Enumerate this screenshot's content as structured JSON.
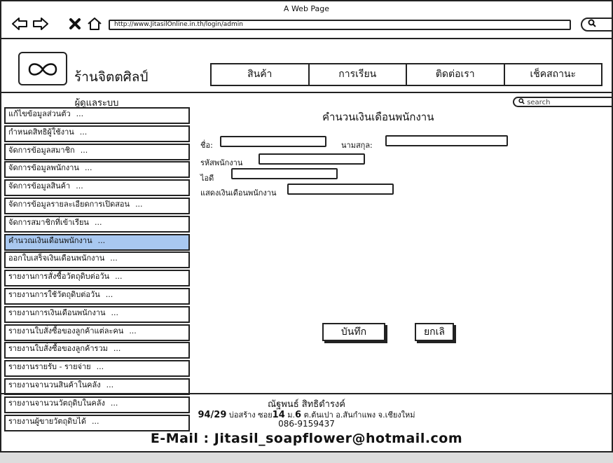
{
  "window": {
    "title": "A Web Page"
  },
  "browser": {
    "url": "http://www.JitasilOnline.in.th/login/admin",
    "back_icon": "back-arrow-icon",
    "forward_icon": "forward-arrow-icon",
    "close_icon": "close-icon",
    "home_icon": "home-icon",
    "search_icon": "search-icon"
  },
  "brand": {
    "name": "ร้านจิตตศิลป์",
    "logo_icon": "infinity-icon"
  },
  "menu": {
    "items": [
      "สินค้า",
      "การเรียน",
      "ติดต่อเรา",
      "เช็คสถานะ"
    ]
  },
  "sidebar": {
    "title": "ผู้ดูแลระบบ",
    "items": [
      {
        "label": "แก้ไขข้อมูลส่วนตัว",
        "dots": "..."
      },
      {
        "label": "กำหนดสิทธิผู้ใช้งาน",
        "dots": "..."
      },
      {
        "label": "จัดการข้อมูลสมาชิก",
        "dots": "..."
      },
      {
        "label": "จัดการข้อมูลพนักงาน",
        "dots": "..."
      },
      {
        "label": "จัดการข้อมูลสินค้า",
        "dots": "..."
      },
      {
        "label": "จัดการข้อมูลรายละเอียดการเปิดสอน",
        "dots": "..."
      },
      {
        "label": "จัดการสมาชิกที่เข้าเรียน",
        "dots": "..."
      },
      {
        "label": "คำนวณเงินเดือนพนักงาน",
        "dots": "..."
      },
      {
        "label": "ออกใบเสร็จเงินเดือนพนักงาน",
        "dots": "..."
      },
      {
        "label": "รายงานการสั่งซื้อวัตถุดิบต่อวัน",
        "dots": "..."
      },
      {
        "label": "รายงานการใช้วัตถุดิบต่อวัน",
        "dots": "..."
      },
      {
        "label": "รายงานการเงินเดือนพนักงาน",
        "dots": "..."
      },
      {
        "label": "รายงานใบสั่งซื้อของลูกค้าแต่ละคน",
        "dots": "..."
      },
      {
        "label": "รายงานใบสั่งซื้อของลูกค้ารวม",
        "dots": "..."
      },
      {
        "label": "รายงานรายรับ - รายจ่าย",
        "dots": "..."
      },
      {
        "label": "รายงานจานวนสินค้าในคลัง",
        "dots": "..."
      },
      {
        "label": "รายงานจานวนวัตถุดิบในคลัง",
        "dots": "..."
      },
      {
        "label": "รายงานผู้ขายวัตถุดิบได้",
        "dots": "..."
      }
    ]
  },
  "main": {
    "search_placeholder": "search",
    "title": "คำนวนเงินเดือนพนักงาน",
    "fields": {
      "first_name_label": "ชื่อ:",
      "last_name_label": "นามสกุล:",
      "employee_id_label": "รหัสพนักงาน",
      "national_id_label": "ไอดี",
      "salary_label": "แสดงเงินเดือนพนักงาน"
    },
    "save_label": "บันทึก",
    "cancel_label": "ยกเลิ"
  },
  "footer": {
    "name": "ณัฐพนธ์ สิทธิดำรงค์",
    "address_num": "94/29",
    "address_a": "บ่อสร้าง ซอย",
    "soi": "14",
    "address_b": "ม.",
    "moo": "6",
    "address_c": "ต.ต้นเปา อ.สันกำแพง จ.เชียงใหม่",
    "phone": "086-9159437",
    "email": "E-Mail : Jitasil_soapflower@hotmail.com"
  }
}
